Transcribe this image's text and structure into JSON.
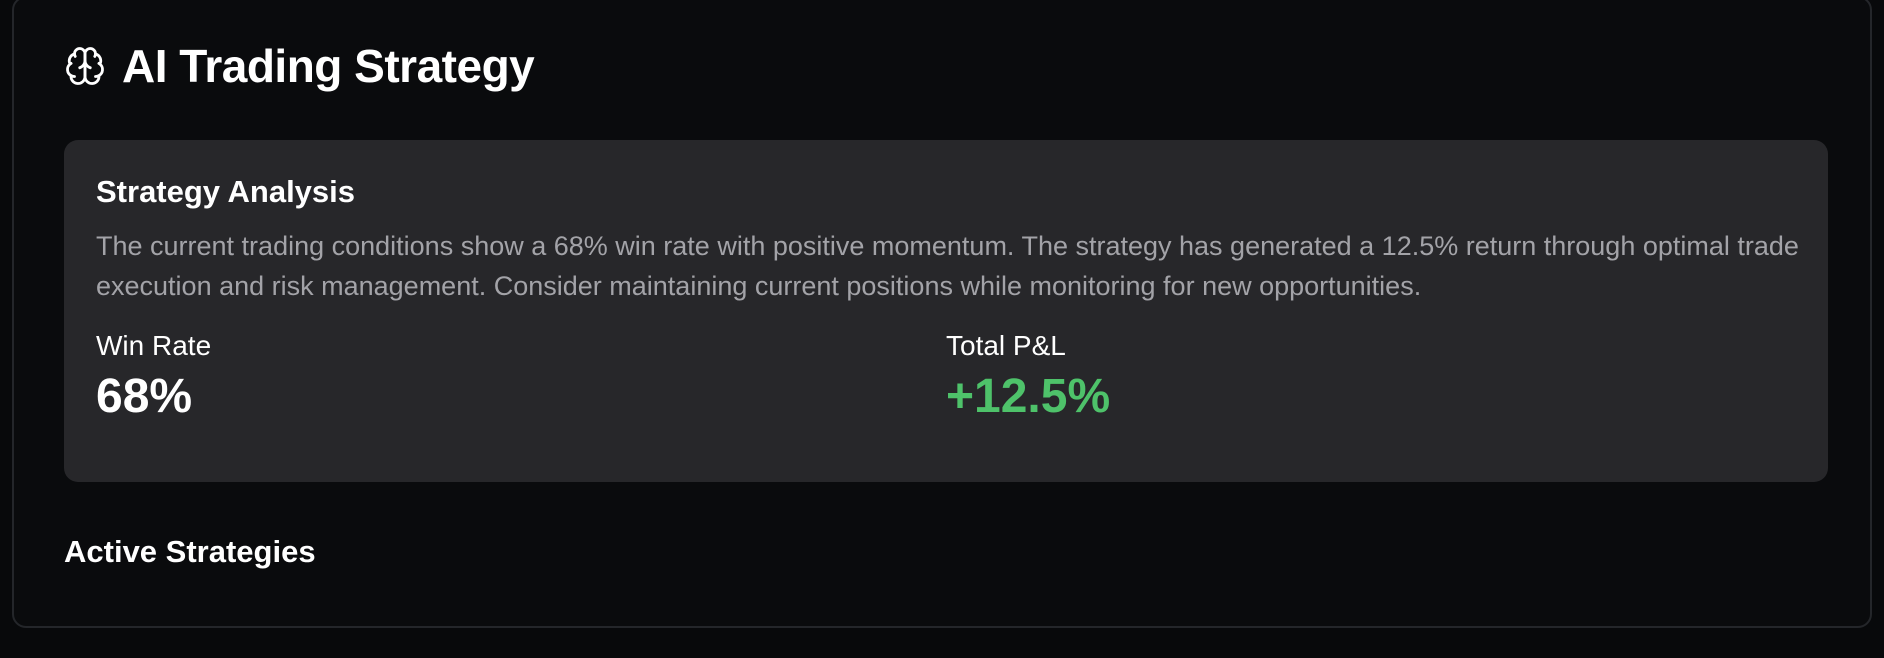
{
  "header": {
    "icon": "brain-icon",
    "title": "AI Trading Strategy"
  },
  "analysis": {
    "title": "Strategy Analysis",
    "body": "The current trading conditions show a 68% win rate with positive momentum. The strategy has generated a 12.5% return through optimal trade execution and risk management. Consider maintaining current positions while monitoring for new opportunities.",
    "metrics": [
      {
        "label": "Win Rate",
        "value": "68%",
        "color": "#ffffff"
      },
      {
        "label": "Total P&L",
        "value": "+12.5%",
        "color": "#4ec26a"
      }
    ]
  },
  "active_strategies": {
    "title": "Active Strategies"
  },
  "colors": {
    "background": "#08090b",
    "card": "#0a0b0d",
    "panel": "#27272a",
    "positive": "#4ec26a",
    "muted_text": "#a3a3a8"
  }
}
